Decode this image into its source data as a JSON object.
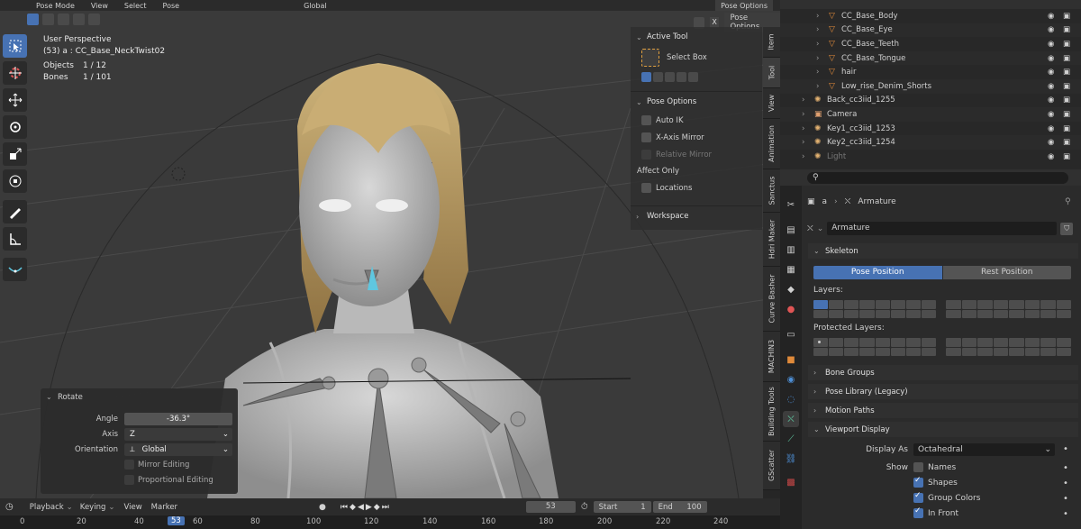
{
  "viewport": {
    "header": {
      "mode": "Pose Mode",
      "menus": [
        "View",
        "Select",
        "Pose"
      ],
      "orientation": "Global",
      "panel_button": "Pose Options"
    },
    "info": {
      "perspective": "User Perspective",
      "active": "(53) a : CC_Base_NeckTwist02",
      "objects_label": "Objects",
      "objects_value": "1 / 12",
      "bones_label": "Bones",
      "bones_value": "1 / 101"
    },
    "toolbar": [
      "select-box",
      "cursor",
      "move",
      "rotate",
      "scale",
      "transform",
      "annotate",
      "measure",
      "relax-pose"
    ]
  },
  "npanel": {
    "active_tool_title": "Active Tool",
    "tool_name": "Select Box",
    "pose_options_title": "Pose Options",
    "auto_ik": "Auto IK",
    "x_axis_mirror": "X-Axis Mirror",
    "relative_mirror": "Relative Mirror",
    "affect_only": "Affect Only",
    "locations": "Locations",
    "workspace": "Workspace"
  },
  "side_tabs": [
    "Item",
    "Tool",
    "View",
    "Animation",
    "Sanctus",
    "Hdri Maker",
    "Curve Basher",
    "MACHIN3",
    "Building Tools",
    "GScatter"
  ],
  "operator": {
    "title": "Rotate",
    "angle_label": "Angle",
    "angle_value": "-36.3°",
    "axis_label": "Axis",
    "axis_value": "Z",
    "orientation_label": "Orientation",
    "orientation_value": "Global",
    "mirror_editing": "Mirror Editing",
    "proportional_editing": "Proportional Editing"
  },
  "timeline": {
    "menus": [
      "Playback",
      "Keying",
      "View",
      "Marker"
    ],
    "current_frame": "53",
    "start_label": "Start",
    "start_value": "1",
    "end_label": "End",
    "end_value": "100",
    "ticks": [
      "0",
      "20",
      "40",
      "53",
      "60",
      "80",
      "100",
      "120",
      "140",
      "160",
      "180",
      "200",
      "220",
      "240"
    ]
  },
  "outliner": {
    "rows": [
      {
        "name": "CC_Base_Body",
        "indent": 2,
        "icon": "mesh"
      },
      {
        "name": "CC_Base_Eye",
        "indent": 2,
        "icon": "mesh"
      },
      {
        "name": "CC_Base_Teeth",
        "indent": 2,
        "icon": "mesh"
      },
      {
        "name": "CC_Base_Tongue",
        "indent": 2,
        "icon": "mesh"
      },
      {
        "name": "hair",
        "indent": 2,
        "icon": "mesh"
      },
      {
        "name": "Low_rise_Denim_Shorts",
        "indent": 2,
        "icon": "mesh"
      },
      {
        "name": "Back_cc3iid_1255",
        "indent": 1,
        "icon": "light"
      },
      {
        "name": "Camera",
        "indent": 1,
        "icon": "camera"
      },
      {
        "name": "Key1_cc3iid_1253",
        "indent": 1,
        "icon": "light"
      },
      {
        "name": "Key2_cc3iid_1254",
        "indent": 1,
        "icon": "light"
      },
      {
        "name": "Light",
        "indent": 1,
        "icon": "light"
      }
    ]
  },
  "properties": {
    "breadcrumb_obj": "a",
    "breadcrumb_data": "Armature",
    "datablock_name": "Armature",
    "skeleton": "Skeleton",
    "pose_position": "Pose Position",
    "rest_position": "Rest Position",
    "layers": "Layers:",
    "protected_layers": "Protected Layers:",
    "bone_groups": "Bone Groups",
    "pose_library": "Pose Library (Legacy)",
    "motion_paths": "Motion Paths",
    "viewport_display": "Viewport Display",
    "display_as_label": "Display As",
    "display_as_value": "Octahedral",
    "show_label": "Show",
    "names": "Names",
    "shapes": "Shapes",
    "group_colors": "Group Colors",
    "in_front": "In Front"
  },
  "colors": {
    "accent": "#4772b3",
    "bg": "#1d1d1d",
    "panel": "#2b2b2b",
    "viewport": "#3a3a3a",
    "frame": "#4772b3"
  }
}
